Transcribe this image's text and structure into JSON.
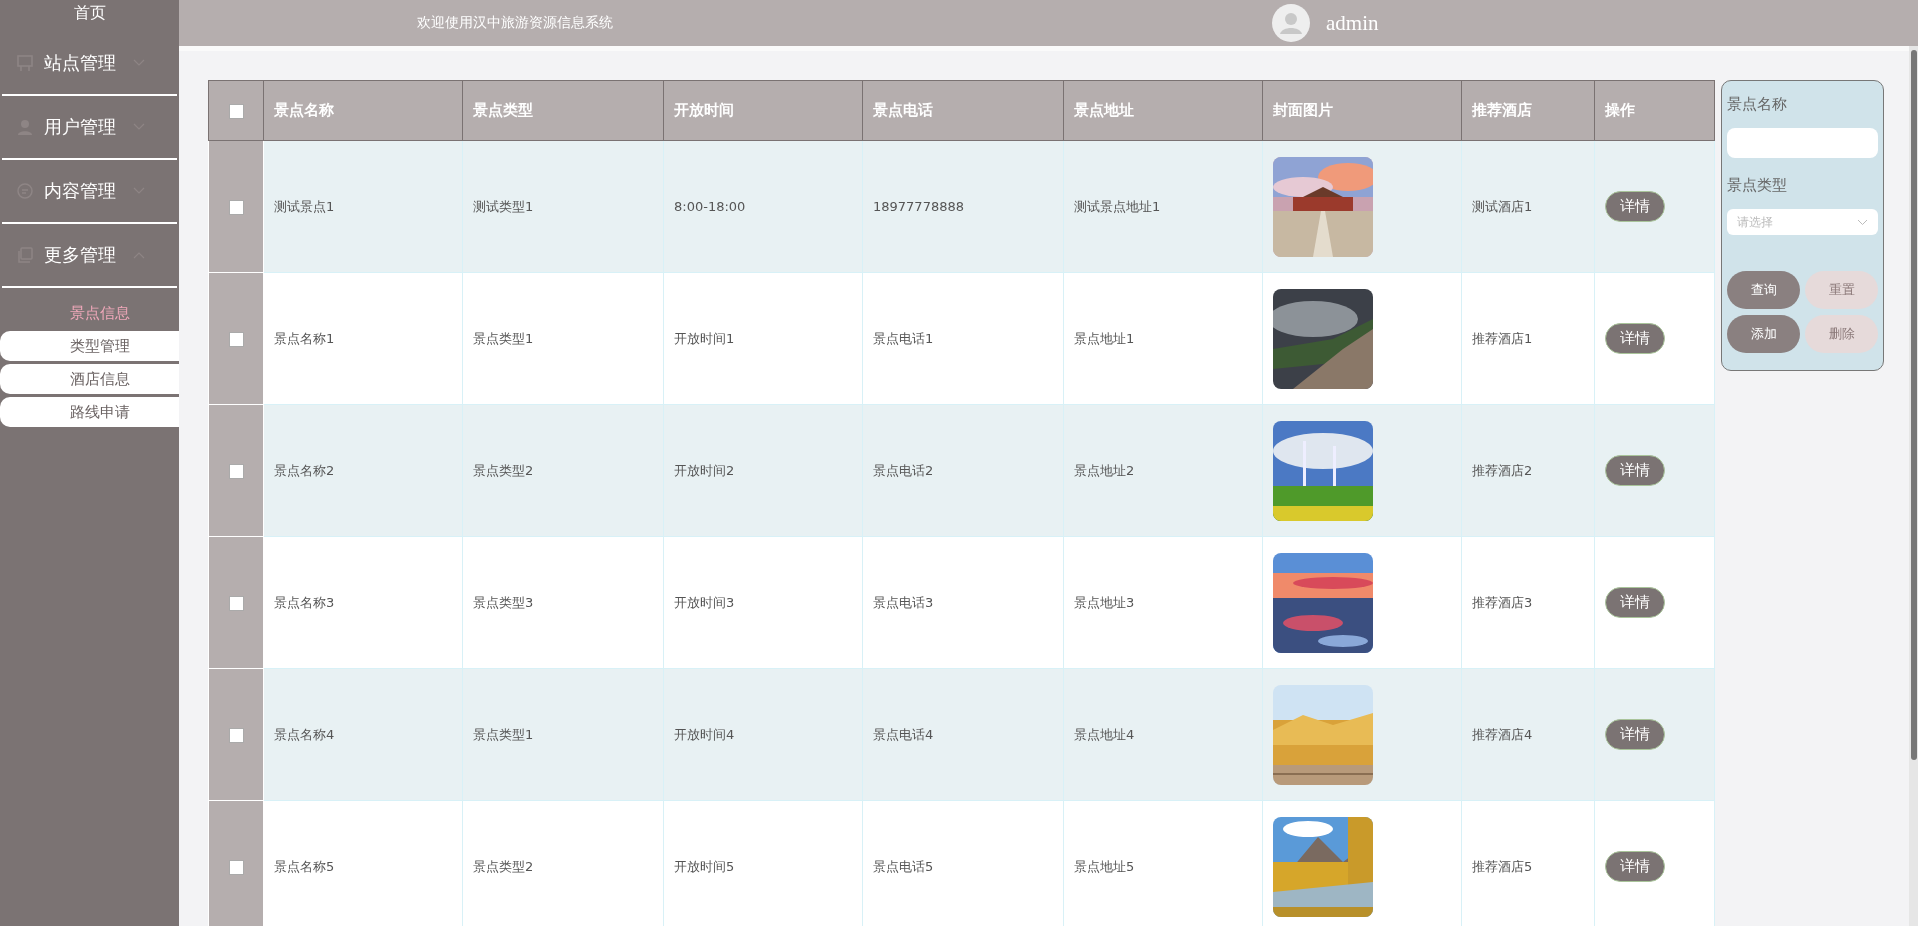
{
  "sidebar": {
    "home": "首页",
    "menus": [
      {
        "label": "站点管理",
        "expanded": false
      },
      {
        "label": "用户管理",
        "expanded": false
      },
      {
        "label": "内容管理",
        "expanded": false
      },
      {
        "label": "更多管理",
        "expanded": true,
        "children": [
          {
            "label": "景点信息",
            "selected": true
          },
          {
            "label": "类型管理",
            "selected": false
          },
          {
            "label": "酒店信息",
            "selected": false
          },
          {
            "label": "路线申请",
            "selected": false
          }
        ]
      }
    ]
  },
  "header": {
    "title": "欢迎使用汉中旅游资源信息系统",
    "user": "admin"
  },
  "table": {
    "select_all": false,
    "columns": [
      "景点名称",
      "景点类型",
      "开放时间",
      "景点电话",
      "景点地址",
      "封面图片",
      "推荐酒店",
      "操作"
    ],
    "rows": [
      {
        "checked": false,
        "cells": [
          "测试景点1",
          "测试类型1",
          "8:00-18:00",
          "18977778888",
          "测试景点地址1"
        ],
        "hotel": "测试酒店1",
        "action": "详情",
        "picture": {
          "kind": "picture"
        }
      },
      {
        "checked": false,
        "cells": [
          "景点名称1",
          "景点类型1",
          "开放时间1",
          "景点电话1",
          "景点地址1"
        ],
        "hotel": "推荐酒店1",
        "action": "详情",
        "picture": {
          "kind": "picture"
        }
      },
      {
        "checked": false,
        "cells": [
          "景点名称2",
          "景点类型2",
          "开放时间2",
          "景点电话2",
          "景点地址2"
        ],
        "hotel": "推荐酒店2",
        "action": "详情",
        "picture": {
          "kind": "picture"
        }
      },
      {
        "checked": false,
        "cells": [
          "景点名称3",
          "景点类型3",
          "开放时间3",
          "景点电话3",
          "景点地址3"
        ],
        "hotel": "推荐酒店3",
        "action": "详情",
        "picture": {
          "kind": "picture"
        }
      },
      {
        "checked": false,
        "cells": [
          "景点名称4",
          "景点类型1",
          "开放时间4",
          "景点电话4",
          "景点地址4"
        ],
        "hotel": "推荐酒店4",
        "action": "详情",
        "picture": {
          "kind": "picture"
        }
      },
      {
        "checked": false,
        "cells": [
          "景点名称5",
          "景点类型2",
          "开放时间5",
          "景点电话5",
          "景点地址5"
        ],
        "hotel": "推荐酒店5",
        "action": "详情",
        "picture": {
          "kind": "picture"
        }
      }
    ]
  },
  "search": {
    "name_label": "景点名称",
    "type_label": "景点类型",
    "type_placeholder": "请选择",
    "buttons": [
      {
        "label": "查询",
        "kind": "dark"
      },
      {
        "label": "重置",
        "kind": "light"
      },
      {
        "label": "添加",
        "kind": "dark"
      },
      {
        "label": "删除",
        "kind": "light"
      }
    ]
  }
}
